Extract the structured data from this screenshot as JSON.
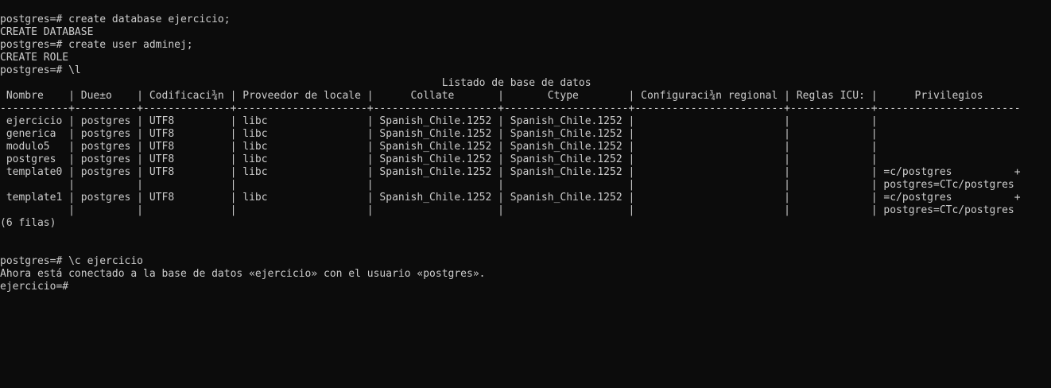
{
  "terminal": {
    "before": [
      "postgres=# create database ejercicio;",
      "CREATE DATABASE",
      "postgres=# create user adminej;",
      "CREATE ROLE",
      "postgres=# \\l"
    ],
    "table": {
      "title": "                                                                       Listado de base de datos",
      "header": " Nombre    | Due±o    | Codificaci¾n | Proveedor de locale |      Collate       |       Ctype        | Configuraci¾n regional | Reglas ICU: |      Privilegios",
      "separator": "-----------+----------+--------------+---------------------+--------------------+--------------------+------------------------+-------------+-----------------------",
      "rows": [
        " ejercicio | postgres | UTF8         | libc                | Spanish_Chile.1252 | Spanish_Chile.1252 |                        |             |",
        " generica  | postgres | UTF8         | libc                | Spanish_Chile.1252 | Spanish_Chile.1252 |                        |             |",
        " modulo5   | postgres | UTF8         | libc                | Spanish_Chile.1252 | Spanish_Chile.1252 |                        |             |",
        " postgres  | postgres | UTF8         | libc                | Spanish_Chile.1252 | Spanish_Chile.1252 |                        |             |",
        " template0 | postgres | UTF8         | libc                | Spanish_Chile.1252 | Spanish_Chile.1252 |                        |             | =c/postgres          +",
        "           |          |              |                     |                    |                    |                        |             | postgres=CTc/postgres",
        " template1 | postgres | UTF8         | libc                | Spanish_Chile.1252 | Spanish_Chile.1252 |                        |             | =c/postgres          +",
        "           |          |              |                     |                    |                    |                        |             | postgres=CTc/postgres"
      ],
      "footer": "(6 filas)"
    },
    "after": [
      "postgres=# \\c ejercicio",
      "Ahora está conectado a la base de datos «ejercicio» con el usuario «postgres».",
      "ejercicio=#"
    ]
  }
}
